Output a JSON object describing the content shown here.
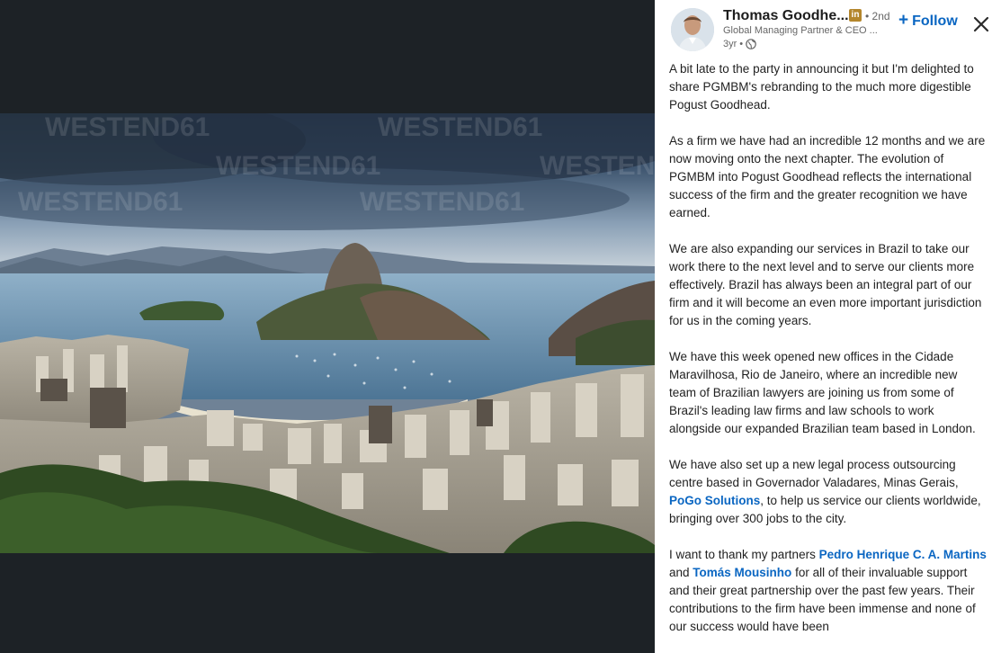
{
  "post": {
    "author_name": "Thomas Goodhe...",
    "badge_letters": "in",
    "degree": "• 2nd",
    "headline": "Global Managing Partner & CEO ...",
    "time": "3yr",
    "meta_sep": "•",
    "follow_plus": "+",
    "follow_label": "Follow",
    "close_icon": "close-icon",
    "paragraphs": {
      "p1": "A bit late to the party in announcing it but I'm delighted to share PGMBM's rebranding to the much more digestible Pogust Goodhead.",
      "p2": "As a firm we have had an incredible 12 months and we are now moving onto the next chapter. The evolution of PGMBM into Pogust Goodhead reflects the international success of the firm and the greater recognition we have earned.",
      "p3": "We are also expanding our services in Brazil to take our work there to the next level and to serve our clients more effectively. Brazil has always been an integral part of our firm and it will become an even more important jurisdiction for us in the coming years.",
      "p4": "We have this week opened new offices in the Cidade Maravilhosa, Rio de Janeiro, where an incredible new team of Brazilian lawyers are joining us from some of Brazil's leading law firms and law schools to work alongside our expanded Brazilian team based in London.",
      "p5_before": "We have also set up a new legal process outsourcing centre based in Governador Valadares, Minas Gerais,",
      "p5_link": "PoGo Solutions",
      "p5_after": ", to help us service our clients worldwide, bringing over 300 jobs to the city.",
      "p6_before": "I want to thank my partners",
      "p6_link1": "Pedro Henrique C. A. Martins",
      "p6_mid": "and",
      "p6_link2": "Tomás Mousinho",
      "p6_after": "for all of their invaluable support and their great partnership over the past few years. Their contributions to the firm have been immense and none of our success would have been"
    }
  },
  "image": {
    "watermark": "WESTEND61"
  },
  "colors": {
    "viewer_bg": "#1d2226",
    "link": "#0a66c2",
    "badge": "#b4862c"
  }
}
